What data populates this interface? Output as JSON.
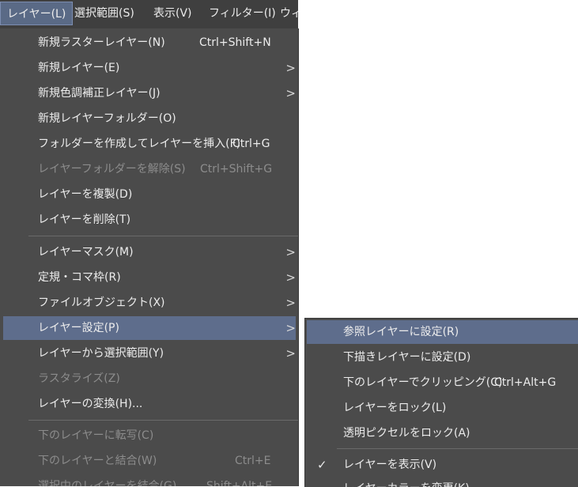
{
  "menubar": {
    "items": [
      {
        "label": "レイヤー(L)",
        "active": true
      },
      {
        "label": "選択範囲(S)"
      },
      {
        "label": "表示(V)"
      },
      {
        "label": "フィルター(I)"
      },
      {
        "label": "ウィ"
      }
    ]
  },
  "layer_menu": {
    "items": [
      {
        "label": "新規ラスターレイヤー(N)",
        "shortcut": "Ctrl+Shift+N"
      },
      {
        "label": "新規レイヤー(E)",
        "submenu": true
      },
      {
        "label": "新規色調補正レイヤー(J)",
        "submenu": true
      },
      {
        "label": "新規レイヤーフォルダー(O)"
      },
      {
        "label": "フォルダーを作成してレイヤーを挿入(F)",
        "shortcut": "Ctrl+G"
      },
      {
        "label": "レイヤーフォルダーを解除(S)",
        "shortcut": "Ctrl+Shift+G",
        "disabled": true
      },
      {
        "label": "レイヤーを複製(D)"
      },
      {
        "label": "レイヤーを削除(T)"
      },
      {
        "label": "レイヤーマスク(M)",
        "submenu": true
      },
      {
        "label": "定規・コマ枠(R)",
        "submenu": true
      },
      {
        "label": "ファイルオブジェクト(X)",
        "submenu": true
      },
      {
        "label": "レイヤー設定(P)",
        "submenu": true,
        "highlighted": true
      },
      {
        "label": "レイヤーから選択範囲(Y)",
        "submenu": true
      },
      {
        "label": "ラスタライズ(Z)",
        "disabled": true
      },
      {
        "label": "レイヤーの変換(H)..."
      },
      {
        "label": "下のレイヤーに転写(C)",
        "disabled": true
      },
      {
        "label": "下のレイヤーと結合(W)",
        "shortcut": "Ctrl+E",
        "disabled": true
      },
      {
        "label": "選択中のレイヤーを結合(G)",
        "shortcut": "Shift+Alt+E",
        "disabled": true
      }
    ]
  },
  "layer_settings_submenu": {
    "items": [
      {
        "label": "参照レイヤーに設定(R)",
        "highlighted": true
      },
      {
        "label": "下描きレイヤーに設定(D)"
      },
      {
        "label": "下のレイヤーでクリッピング(C)",
        "shortcut": "Ctrl+Alt+G"
      },
      {
        "label": "レイヤーをロック(L)"
      },
      {
        "label": "透明ピクセルをロック(A)"
      },
      {
        "label": "レイヤーを表示(V)",
        "checked": true
      },
      {
        "label": "レイヤーカラーを変更(K)"
      }
    ]
  },
  "icons": {
    "submenu_arrow": ">",
    "check": "✓"
  }
}
